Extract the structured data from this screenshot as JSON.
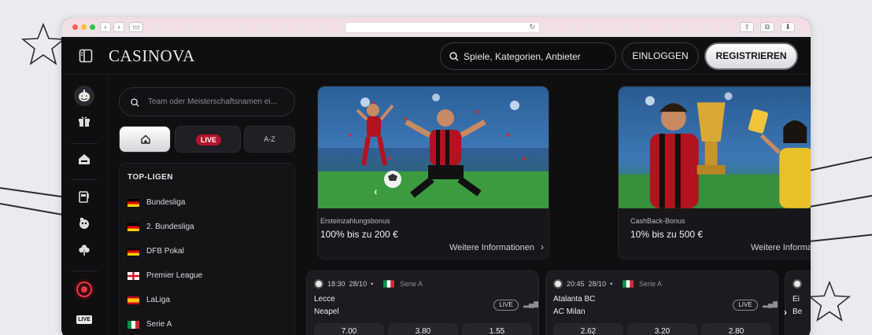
{
  "brand": {
    "logo": "CASINOVA"
  },
  "header": {
    "search_placeholder": "Spiele, Kategorien, Anbieter",
    "login_label": "EINLOGGEN",
    "register_label": "REGISTRIEREN"
  },
  "sidebar": {
    "search_placeholder": "Team oder Meisterschaftsnamen ei...",
    "tabs": {
      "live": "LIVE",
      "az": "A-Z"
    },
    "top_leagues_title": "TOP-LIGEN",
    "leagues": [
      {
        "name": "Bundesliga",
        "flag": "germany"
      },
      {
        "name": "2. Bundesliga",
        "flag": "germany"
      },
      {
        "name": "DFB Pokal",
        "flag": "germany"
      },
      {
        "name": "Premier League",
        "flag": "england"
      },
      {
        "name": "LaLiga",
        "flag": "spain"
      },
      {
        "name": "Serie A",
        "flag": "italy"
      }
    ]
  },
  "rail": {
    "live_label": "LIVE",
    "icons": [
      "pumpkin-icon",
      "gift-icon",
      "casino-icon",
      "slot-machine-icon",
      "poker-icon",
      "clover-icon",
      "roulette-icon",
      "live-icon"
    ]
  },
  "promos": [
    {
      "subtitle": "Ersteinzahlungsbonus",
      "headline": "100% bis zu 200 €",
      "more": "Weitere Informationen"
    },
    {
      "subtitle": "CashBack-Bonus",
      "headline": "10% bis zu 500 €",
      "more": "Weitere Informationen"
    }
  ],
  "matches": [
    {
      "time": "18:30",
      "date": "28/10",
      "league": "Serie A",
      "team1": "Lecce",
      "team2": "Neapel",
      "live": "LIVE",
      "odds": [
        "7.00",
        "3.80",
        "1.55"
      ]
    },
    {
      "time": "20:45",
      "date": "28/10",
      "league": "Serie A",
      "team1": "Atalanta BC",
      "team2": "AC Milan",
      "live": "LIVE",
      "odds": [
        "2.62",
        "3.20",
        "2.80"
      ]
    }
  ],
  "partial_card": {
    "team1": "Ei",
    "team2": "Be"
  },
  "colors": {
    "accent_live": "#b3142b",
    "background": "#0f0f11",
    "page_bg": "#e9ebf1"
  }
}
